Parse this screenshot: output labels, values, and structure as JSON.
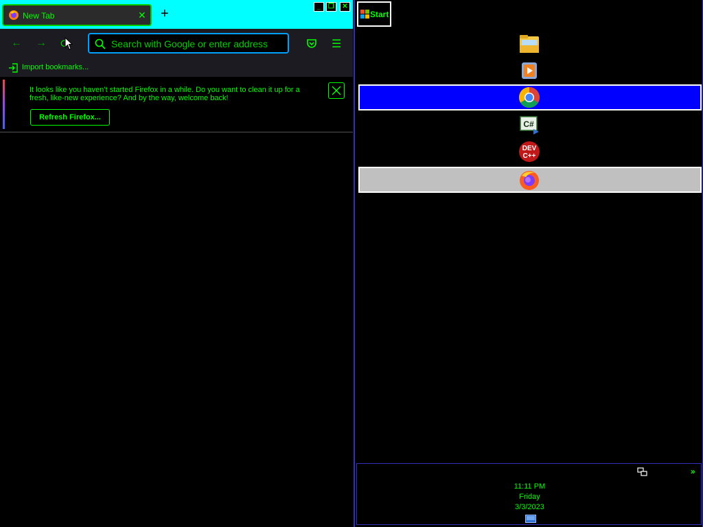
{
  "browser": {
    "tab": {
      "title": "New Tab",
      "close": "✕"
    },
    "new_tab": "+",
    "window_buttons": {
      "minimize": "_",
      "restore": "❐",
      "close": "✕"
    },
    "nav": {
      "back": "←",
      "forward": "→",
      "reload": "⟳",
      "pocket": "pocket-icon",
      "menu": "☰"
    },
    "urlbar": {
      "placeholder": "Search with Google or enter address",
      "value": ""
    },
    "bookmarks": {
      "import_label": "Import bookmarks..."
    },
    "notice": {
      "text": "It looks like you haven’t started Firefox in a while. Do you want to clean it up for a fresh, like-new experience? And by the way, welcome back!",
      "button": "Refresh Firefox..."
    }
  },
  "taskbar": {
    "start_label": "Start",
    "tasks": [
      {
        "name": "file-explorer-icon",
        "active": false,
        "highlight": "none"
      },
      {
        "name": "media-player-icon",
        "active": false,
        "highlight": "none"
      },
      {
        "name": "chrome-icon",
        "active": true,
        "highlight": "#0000ff"
      },
      {
        "name": "csharp-icon",
        "active": false,
        "highlight": "none"
      },
      {
        "name": "devcpp-icon",
        "active": false,
        "highlight": "none"
      },
      {
        "name": "firefox-icon",
        "active": true,
        "highlight": "#c0c0c0"
      }
    ],
    "tray": {
      "expand": "»",
      "time": "11:11 PM",
      "day": "Friday",
      "date": "3/3/2023"
    }
  },
  "colors": {
    "accent": "#00ff00",
    "tabbar": "#00ffff",
    "border": "#3030c0"
  }
}
